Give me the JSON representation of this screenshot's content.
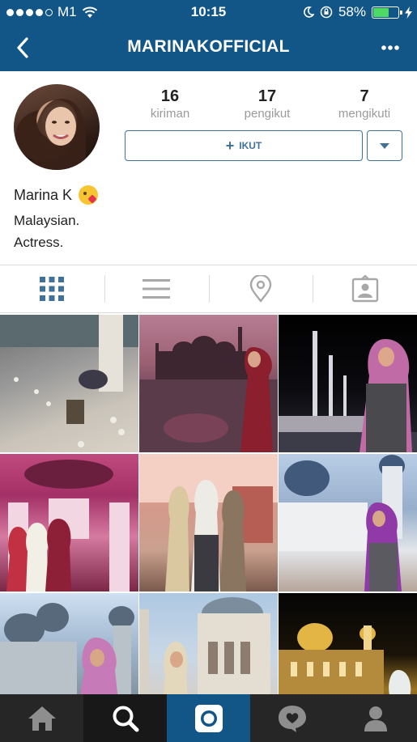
{
  "status_bar": {
    "carrier": "M1",
    "time": "10:15",
    "battery": "58%",
    "signal_bars_filled": 4,
    "signal_bars_total": 5
  },
  "nav": {
    "title": "MARINAKOFFICIAL",
    "back_icon": "chevron-left-icon",
    "more_icon": "more-dots-icon"
  },
  "profile": {
    "stats": [
      {
        "value": "16",
        "label": "kiriman"
      },
      {
        "value": "17",
        "label": "pengikut"
      },
      {
        "value": "7",
        "label": "mengikuti"
      }
    ],
    "follow_label": "IKUT",
    "name": "Marina K",
    "bio_line1": "Malaysian.",
    "bio_line2": "Actress."
  },
  "view_tabs": [
    "grid-view-icon",
    "list-view-icon",
    "location-pin-icon",
    "tagged-photos-icon"
  ],
  "posts_count_shown": 9,
  "bottom_tabs": [
    "home-icon",
    "search-icon",
    "camera-icon",
    "activity-heart-icon",
    "profile-icon"
  ],
  "colors": {
    "header": "#125688",
    "accent": "#3f729b",
    "grid_active": "#3f729b",
    "tabbar": "#262626",
    "battery_fill": "#4cd964"
  }
}
